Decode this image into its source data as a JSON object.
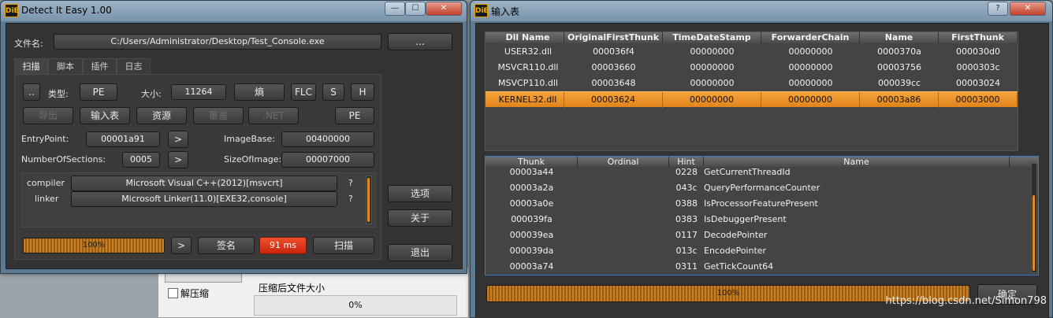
{
  "background_app": {
    "checkbox_label": "解压缩",
    "size_label": "压缩后文件大小",
    "progress": "0%"
  },
  "die": {
    "title": "Detect It Easy 1.00",
    "file_label": "文件名:",
    "file_path": "C:/Users/Administrator/Desktop/Test_Console.exe",
    "browse": "...",
    "tabs": [
      "扫描",
      "脚本",
      "插件",
      "日志"
    ],
    "dotdot": "..",
    "type_label": "类型:",
    "type_value": "PE",
    "size_label": "大小:",
    "size_value": "11264",
    "entropy": "熵",
    "flc": "FLC",
    "s": "S",
    "h": "H",
    "export": "导出",
    "import": "输入表",
    "resource": "资源",
    "overlay": "覆盖",
    "dotnet": ".NET",
    "pe": "PE",
    "ep_label": "EntryPoint:",
    "ep_value": "00001a91",
    "imagebase_label": "ImageBase:",
    "imagebase_value": "00400000",
    "nos_label": "NumberOfSections:",
    "nos_value": "0005",
    "soi_label": "SizeOfImage:",
    "soi_value": "00007000",
    "arrow": ">",
    "results": [
      {
        "type": "compiler",
        "value": "Microsoft Visual C++(2012)[msvcrt]",
        "q": "?"
      },
      {
        "type": "linker",
        "value": "Microsoft Linker(11.0)[EXE32,console]",
        "q": "?"
      }
    ],
    "progress": "100%",
    "signature": "签名",
    "time": "91 ms",
    "scan": "扫描",
    "options": "选项",
    "about": "关于",
    "exit": "退出"
  },
  "imports": {
    "title": "输入表",
    "dll_columns": [
      "Dll Name",
      "OriginalFirstThunk",
      "TimeDateStamp",
      "ForwarderChain",
      "Name",
      "FirstThunk"
    ],
    "dll_rows": [
      [
        "USER32.dll",
        "000036f4",
        "00000000",
        "00000000",
        "0000370a",
        "000030d0"
      ],
      [
        "MSVCR110.dll",
        "00003660",
        "00000000",
        "00000000",
        "00003756",
        "0000303c"
      ],
      [
        "MSVCP110.dll",
        "00003648",
        "00000000",
        "00000000",
        "000039cc",
        "00003024"
      ],
      [
        "KERNEL32.dll",
        "00003624",
        "00000000",
        "00000000",
        "00003a86",
        "00003000"
      ]
    ],
    "selected_row": 3,
    "func_columns": [
      "Thunk",
      "Ordinal",
      "Hint",
      "Name"
    ],
    "func_rows": [
      [
        "00003a44",
        "",
        "0228",
        "GetCurrentThreadId"
      ],
      [
        "00003a2a",
        "",
        "043c",
        "QueryPerformanceCounter"
      ],
      [
        "00003a0e",
        "",
        "0388",
        "IsProcessorFeaturePresent"
      ],
      [
        "000039fa",
        "",
        "0383",
        "IsDebuggerPresent"
      ],
      [
        "000039ea",
        "",
        "0117",
        "DecodePointer"
      ],
      [
        "000039da",
        "",
        "013c",
        "EncodePointer"
      ],
      [
        "00003a74",
        "",
        "0311",
        "GetTickCount64"
      ]
    ],
    "progress": "100%",
    "ok": "确定",
    "help": "?",
    "close": "✕"
  },
  "watermark": "https://blog.csdn.net/Simon798",
  "colors": {
    "accent": "#e0841a",
    "panel": "#333333",
    "title_bar": "#7893aa"
  }
}
